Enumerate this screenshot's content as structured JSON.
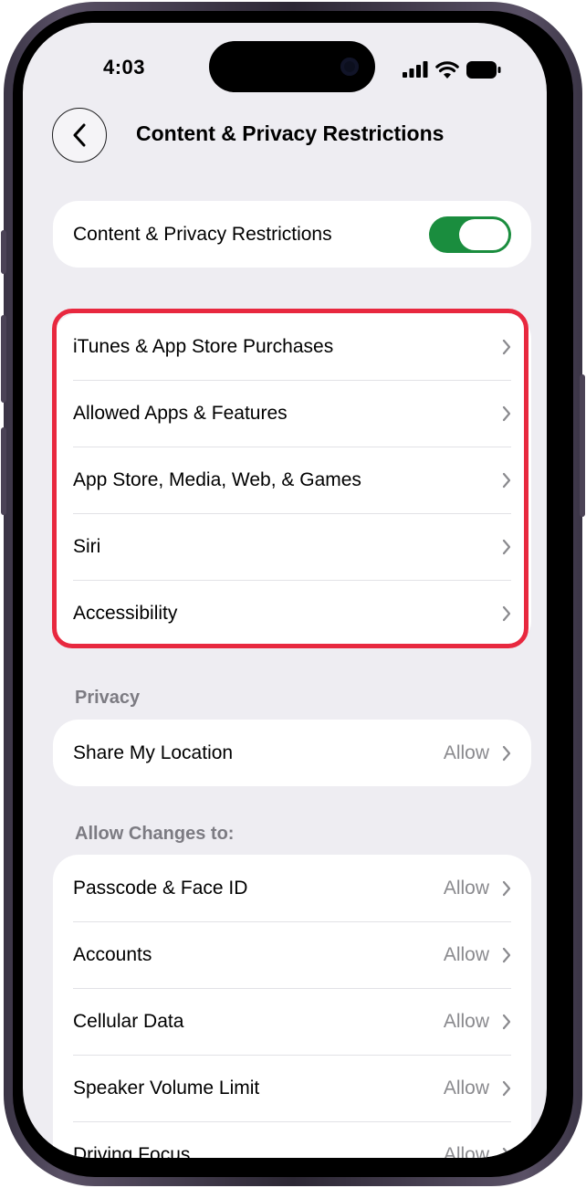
{
  "status_bar": {
    "time": "4:03"
  },
  "nav": {
    "back_icon": "chevron-left-icon",
    "title": "Content & Privacy Restrictions"
  },
  "main_toggle": {
    "label": "Content & Privacy Restrictions",
    "on": true,
    "color": "#1a8d3e"
  },
  "restrictions": {
    "items": [
      {
        "label": "iTunes & App Store Purchases"
      },
      {
        "label": "Allowed Apps & Features"
      },
      {
        "label": "App Store, Media, Web, & Games"
      },
      {
        "label": "Siri"
      },
      {
        "label": "Accessibility"
      }
    ],
    "highlight_color": "#e8283f"
  },
  "privacy": {
    "header": "Privacy",
    "items": [
      {
        "label": "Share My Location",
        "value": "Allow"
      }
    ]
  },
  "allow_changes": {
    "header": "Allow Changes to:",
    "items": [
      {
        "label": "Passcode & Face ID",
        "value": "Allow"
      },
      {
        "label": "Accounts",
        "value": "Allow"
      },
      {
        "label": "Cellular Data",
        "value": "Allow"
      },
      {
        "label": "Speaker Volume Limit",
        "value": "Allow"
      },
      {
        "label": "Driving Focus",
        "value": "Allow"
      }
    ]
  }
}
